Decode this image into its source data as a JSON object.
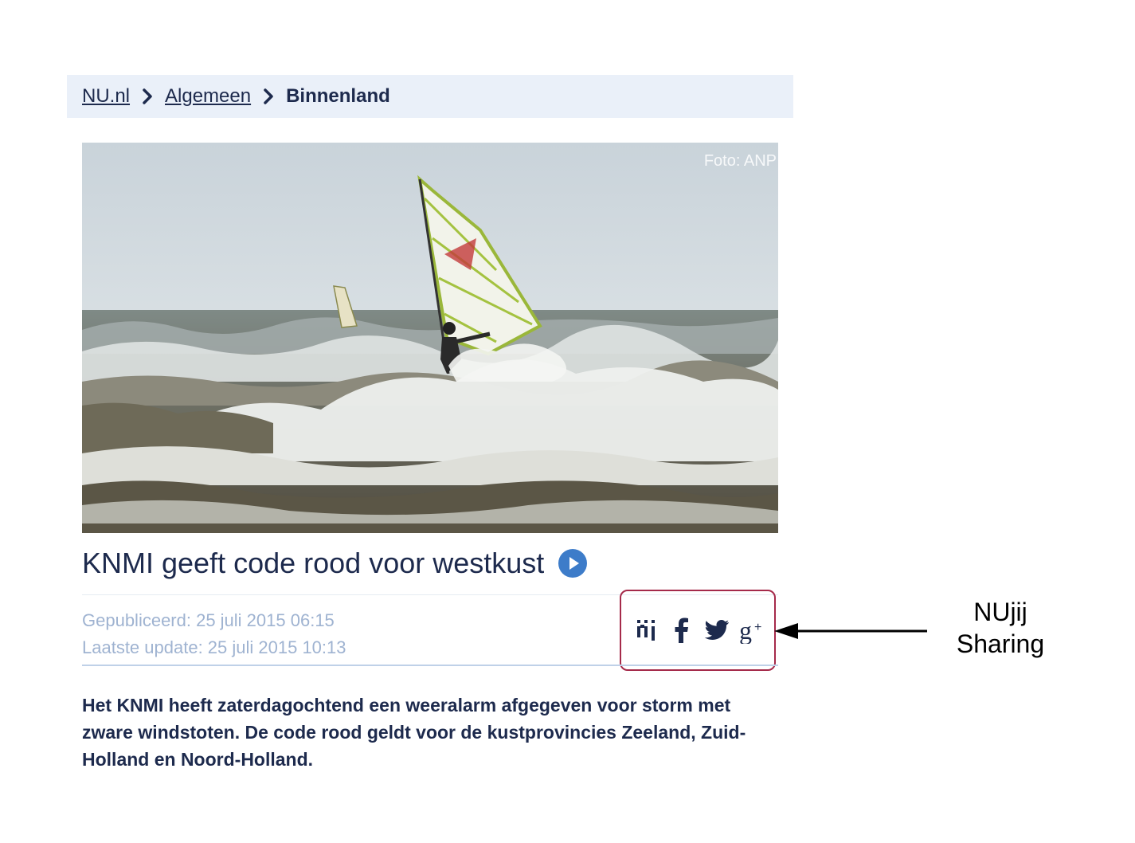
{
  "breadcrumb": {
    "items": [
      {
        "label": "NU.nl"
      },
      {
        "label": "Algemeen"
      }
    ],
    "current": "Binnenland"
  },
  "hero": {
    "credit": "Foto: ANP"
  },
  "article": {
    "title": "KNMI geeft code rood voor westkust",
    "published": "Gepubliceerd: 25 juli 2015 06:15",
    "updated": "Laatste update: 25 juli 2015 10:13",
    "lead": "Het KNMI heeft zaterdagochtend een weeralarm afgegeven voor storm met zware windstoten. De code rood geldt voor de kustprovincies Zeeland, Zuid-Holland en Noord-Holland."
  },
  "share": {
    "icons": [
      "nujij-icon",
      "facebook-icon",
      "twitter-icon",
      "google-plus-icon"
    ]
  },
  "annotation": {
    "line1": "NUjij",
    "line2": "Sharing"
  },
  "colors": {
    "text": "#1d2a4d",
    "breadcrumb_bg": "#eaf0f9",
    "meta": "#9fb3d1",
    "highlight_box": "#a52a4a",
    "play_icon": "#3d7cc9"
  }
}
